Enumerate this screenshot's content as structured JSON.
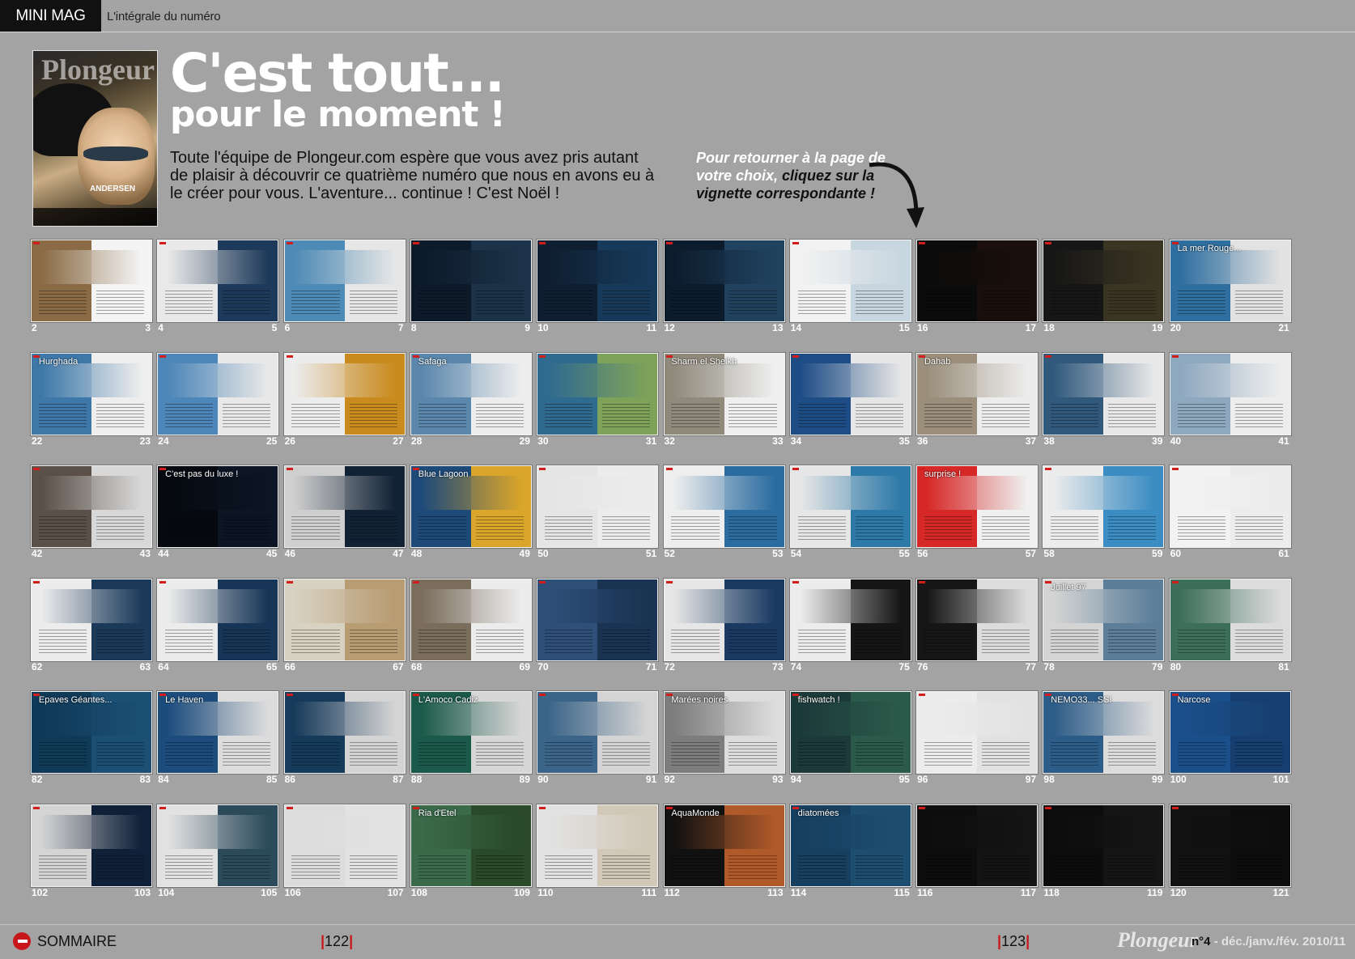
{
  "header": {
    "brand": "MINI MAG",
    "subtitle": "L'intégrale du numéro"
  },
  "cover": {
    "logo": "Plongeur",
    "name": "ANDERSEN"
  },
  "headline": {
    "line1": "C'est tout...",
    "line2": "pour le moment !"
  },
  "intro": "Toute l'équipe de Plongeur.com espère que vous avez pris autant de plaisir à découvrir ce quatrième numéro que nous en avons eu à le créer pour vous. L'aventure... continue ! C'est Noël !",
  "hint": {
    "text": "Pour retourner à la page de votre choix,",
    "emphasis": "cliquez sur la vignette correspondante !"
  },
  "thumbnails": [
    {
      "left": "2",
      "right": "3",
      "caption": "",
      "colors": [
        "#8a6b45",
        "#f4f4f4"
      ]
    },
    {
      "left": "4",
      "right": "5",
      "caption": "",
      "colors": [
        "#e9e9e9",
        "#1e3a5a"
      ]
    },
    {
      "left": "6",
      "right": "7",
      "caption": "",
      "colors": [
        "#4d8ab5",
        "#e6e6e6"
      ]
    },
    {
      "left": "8",
      "right": "9",
      "caption": "",
      "colors": [
        "#0d1a2a",
        "#1b3248"
      ]
    },
    {
      "left": "10",
      "right": "11",
      "caption": "",
      "colors": [
        "#0f1e30",
        "#173a5a"
      ]
    },
    {
      "left": "12",
      "right": "13",
      "caption": "",
      "colors": [
        "#0d1c2d",
        "#20425f"
      ]
    },
    {
      "left": "14",
      "right": "15",
      "caption": "",
      "colors": [
        "#f2f2f2",
        "#c8d6e0"
      ]
    },
    {
      "left": "16",
      "right": "17",
      "caption": "",
      "colors": [
        "#0b0b0b",
        "#1a0f0a"
      ]
    },
    {
      "left": "18",
      "right": "19",
      "caption": "",
      "colors": [
        "#161616",
        "#3a3522"
      ]
    },
    {
      "left": "20",
      "right": "21",
      "caption": "La mer Rouge...",
      "colors": [
        "#2f6fa0",
        "#e2e2e2"
      ]
    },
    {
      "left": "22",
      "right": "23",
      "caption": "Hurghada",
      "colors": [
        "#3e78a8",
        "#eeeeee"
      ]
    },
    {
      "left": "24",
      "right": "25",
      "caption": "",
      "colors": [
        "#4d86b8",
        "#e8e8e8"
      ]
    },
    {
      "left": "26",
      "right": "27",
      "caption": "",
      "colors": [
        "#ececec",
        "#c98a1e"
      ]
    },
    {
      "left": "28",
      "right": "29",
      "caption": "Safaga",
      "colors": [
        "#5b87ad",
        "#ededed"
      ]
    },
    {
      "left": "30",
      "right": "31",
      "caption": "",
      "colors": [
        "#2f6a8f",
        "#7ea25a"
      ]
    },
    {
      "left": "32",
      "right": "33",
      "caption": "Sharm el Sheikh",
      "colors": [
        "#8f8a7c",
        "#efefef"
      ]
    },
    {
      "left": "34",
      "right": "35",
      "caption": "",
      "colors": [
        "#1e4d86",
        "#e6e6e6"
      ]
    },
    {
      "left": "36",
      "right": "37",
      "caption": "Dahab",
      "colors": [
        "#9b8f7c",
        "#ececec"
      ]
    },
    {
      "left": "38",
      "right": "39",
      "caption": "",
      "colors": [
        "#30597c",
        "#e8e8e8"
      ]
    },
    {
      "left": "40",
      "right": "41",
      "caption": "",
      "colors": [
        "#8ea8bf",
        "#ededed"
      ]
    },
    {
      "left": "42",
      "right": "43",
      "caption": "",
      "colors": [
        "#5a5048",
        "#d8d8d8"
      ]
    },
    {
      "left": "44",
      "right": "45",
      "caption": "C'est pas du luxe !",
      "colors": [
        "#060a10",
        "#0b1524"
      ]
    },
    {
      "left": "46",
      "right": "47",
      "caption": "",
      "colors": [
        "#cfcfcf",
        "#122235"
      ]
    },
    {
      "left": "48",
      "right": "49",
      "caption": "Blue Lagoon",
      "colors": [
        "#1e4a79",
        "#d9a52a"
      ]
    },
    {
      "left": "50",
      "right": "51",
      "caption": "",
      "colors": [
        "#e5e5e5",
        "#ececec"
      ]
    },
    {
      "left": "52",
      "right": "53",
      "caption": "",
      "colors": [
        "#eeeeee",
        "#2b6ca0"
      ]
    },
    {
      "left": "54",
      "right": "55",
      "caption": "",
      "colors": [
        "#e6e6e6",
        "#2d79a8"
      ]
    },
    {
      "left": "56",
      "right": "57",
      "caption": "surprise !",
      "colors": [
        "#d72828",
        "#f0f0f0"
      ]
    },
    {
      "left": "58",
      "right": "59",
      "caption": "",
      "colors": [
        "#ececec",
        "#3b8cc2"
      ]
    },
    {
      "left": "60",
      "right": "61",
      "caption": "",
      "colors": [
        "#f2f2f2",
        "#ececec"
      ]
    },
    {
      "left": "62",
      "right": "63",
      "caption": "",
      "colors": [
        "#ececec",
        "#1b3a5a"
      ]
    },
    {
      "left": "64",
      "right": "65",
      "caption": "",
      "colors": [
        "#ececec",
        "#173556"
      ]
    },
    {
      "left": "66",
      "right": "67",
      "caption": "",
      "colors": [
        "#d8d2c2",
        "#b89c72"
      ]
    },
    {
      "left": "68",
      "right": "69",
      "caption": "",
      "colors": [
        "#7a6d5c",
        "#ececec"
      ]
    },
    {
      "left": "70",
      "right": "71",
      "caption": "",
      "colors": [
        "#2d4f78",
        "#1a3352"
      ]
    },
    {
      "left": "72",
      "right": "73",
      "caption": "",
      "colors": [
        "#e6e6e6",
        "#1a3a62"
      ]
    },
    {
      "left": "74",
      "right": "75",
      "caption": "",
      "colors": [
        "#ececec",
        "#151515"
      ]
    },
    {
      "left": "76",
      "right": "77",
      "caption": "",
      "colors": [
        "#161616",
        "#dcdcdc"
      ]
    },
    {
      "left": "78",
      "right": "79",
      "caption": "Juillet 97",
      "colors": [
        "#d4d4d4",
        "#5c7e99"
      ]
    },
    {
      "left": "80",
      "right": "81",
      "caption": "",
      "colors": [
        "#3d6e5a",
        "#dcdcdc"
      ]
    },
    {
      "left": "82",
      "right": "83",
      "caption": "Epaves Géantes...",
      "colors": [
        "#0f3a58",
        "#1b4f74"
      ]
    },
    {
      "left": "84",
      "right": "85",
      "caption": "Le Haven",
      "colors": [
        "#1c4c7c",
        "#dcdcdc"
      ]
    },
    {
      "left": "86",
      "right": "87",
      "caption": "",
      "colors": [
        "#163a5a",
        "#d4d4d4"
      ]
    },
    {
      "left": "88",
      "right": "89",
      "caption": "L'Amoco Cadiz",
      "colors": [
        "#1b5a4a",
        "#d6d6d6"
      ]
    },
    {
      "left": "90",
      "right": "91",
      "caption": "",
      "colors": [
        "#3a6488",
        "#d4d4d4"
      ]
    },
    {
      "left": "92",
      "right": "93",
      "caption": "Marées noires",
      "colors": [
        "#7d7d7d",
        "#dcdcdc"
      ]
    },
    {
      "left": "94",
      "right": "95",
      "caption": "fishwatch !",
      "colors": [
        "#1d3a3a",
        "#2b5a4a"
      ]
    },
    {
      "left": "96",
      "right": "97",
      "caption": "",
      "colors": [
        "#ececec",
        "#e2e2e2"
      ]
    },
    {
      "left": "98",
      "right": "99",
      "caption": "NEMO33... SSI",
      "colors": [
        "#2c5c88",
        "#dcdcdc"
      ]
    },
    {
      "left": "100",
      "right": "101",
      "caption": "Narcose",
      "colors": [
        "#1b4f8a",
        "#163f6f"
      ]
    },
    {
      "left": "102",
      "right": "103",
      "caption": "",
      "colors": [
        "#d4d4d4",
        "#0f2038"
      ]
    },
    {
      "left": "104",
      "right": "105",
      "caption": "",
      "colors": [
        "#e2e2e2",
        "#2b4a5a"
      ]
    },
    {
      "left": "106",
      "right": "107",
      "caption": "",
      "colors": [
        "#dcdcdc",
        "#e2e2e2"
      ]
    },
    {
      "left": "108",
      "right": "109",
      "caption": "Ria d'Etel",
      "colors": [
        "#3a6a4a",
        "#2a4a2a"
      ]
    },
    {
      "left": "110",
      "right": "111",
      "caption": "",
      "colors": [
        "#e2e2e2",
        "#d2c8b8"
      ]
    },
    {
      "left": "112",
      "right": "113",
      "caption": "AquaMonde",
      "colors": [
        "#111111",
        "#b05a2a"
      ]
    },
    {
      "left": "114",
      "right": "115",
      "caption": "diatomées",
      "colors": [
        "#173f5f",
        "#1d4d6f"
      ]
    },
    {
      "left": "116",
      "right": "117",
      "caption": "",
      "colors": [
        "#0d0d0d",
        "#141414"
      ]
    },
    {
      "left": "118",
      "right": "119",
      "caption": "",
      "colors": [
        "#0c0c0c",
        "#151515"
      ]
    },
    {
      "left": "120",
      "right": "121",
      "caption": "",
      "colors": [
        "#111111",
        "#0d0d0d"
      ]
    }
  ],
  "footer": {
    "sommaire": "SOMMAIRE",
    "page_left": "122",
    "page_right": "123",
    "logo": "Plongeur",
    "issue": "n°4",
    "date": "- déc./janv./fév. 2010/11"
  }
}
